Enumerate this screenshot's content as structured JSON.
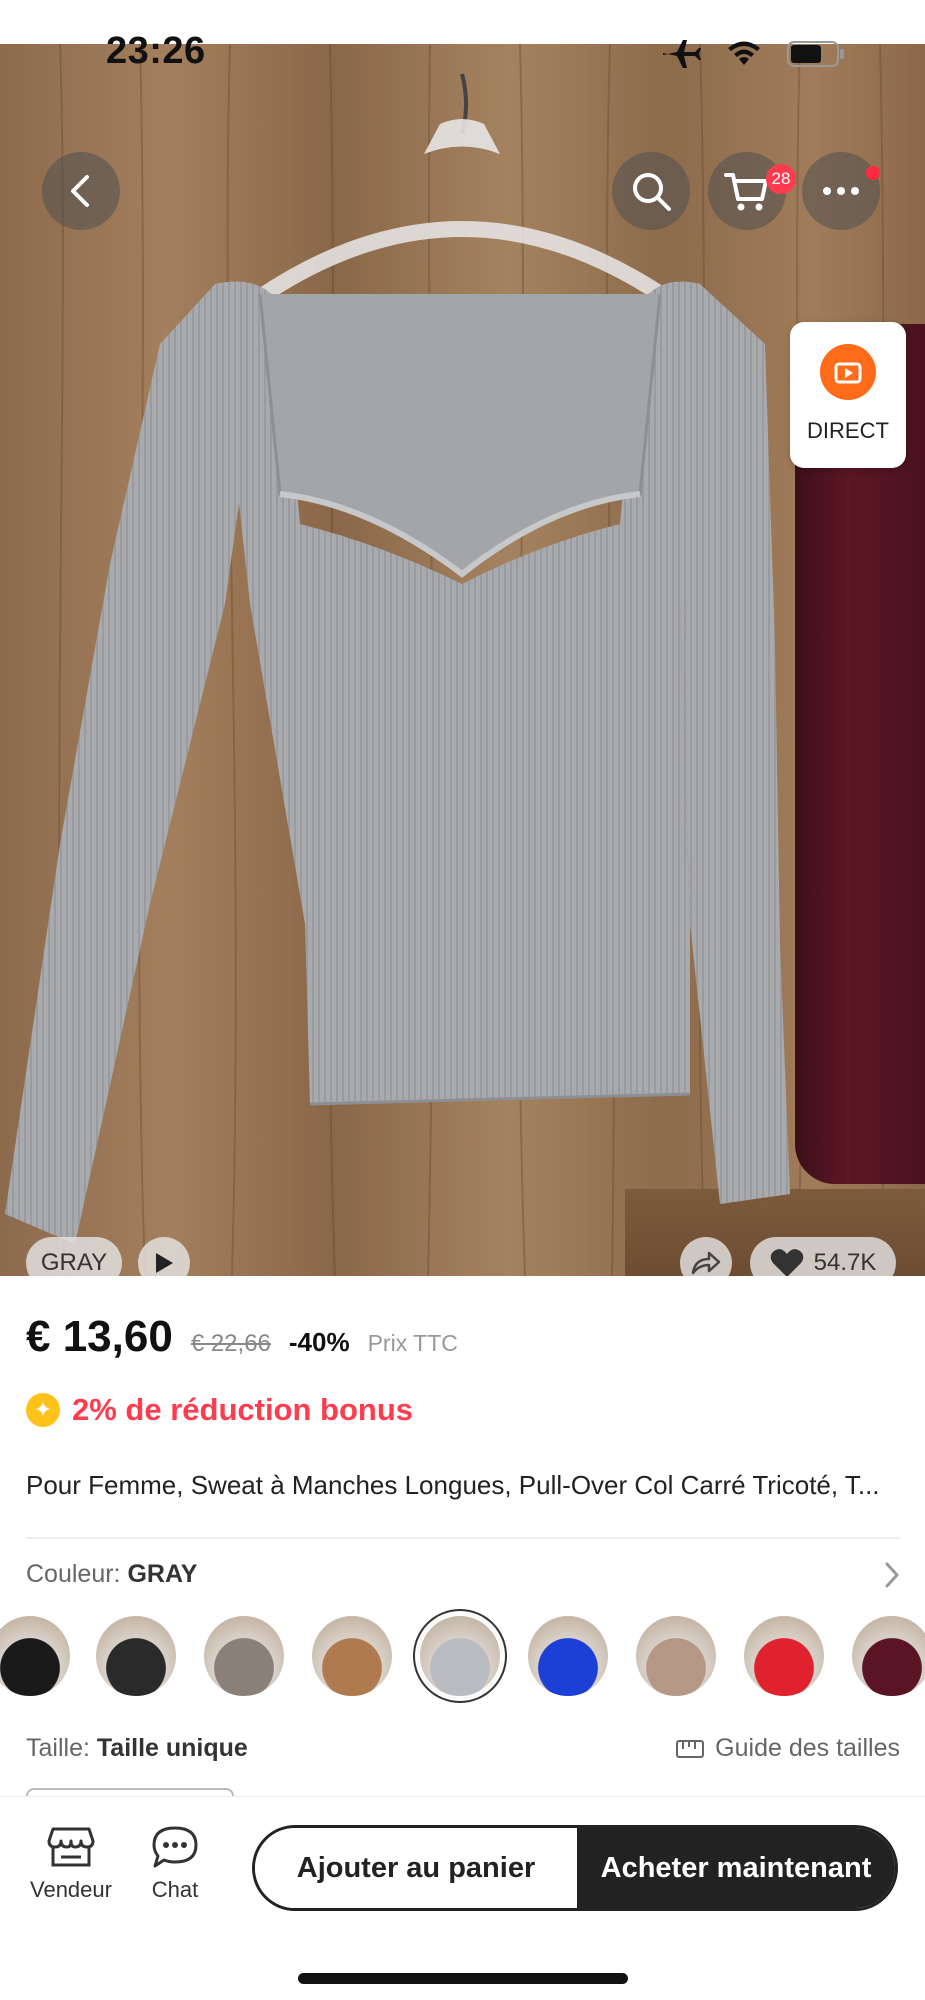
{
  "status_bar": {
    "time": "23:26",
    "icons": [
      "airplane-icon",
      "wifi-icon",
      "battery-icon"
    ]
  },
  "hero": {
    "cart_count": "28",
    "live_label": "DIRECT",
    "selected_color_tag": "GRAY",
    "likes": "54.7K"
  },
  "product": {
    "price": "€ 13,60",
    "old_price": "€ 22,66",
    "discount": "-40%",
    "tax_note": "Prix TTC",
    "bonus": "2% de réduction bonus",
    "title": "Pour Femme, Sweat à Manches Longues, Pull-Over Col Carré Tricoté, T..."
  },
  "color": {
    "label": "Couleur: ",
    "value": "GRAY",
    "swatches": [
      {
        "name": "white-black",
        "color": "#1a1a1a",
        "selected": false
      },
      {
        "name": "black",
        "color": "#2a2a2a",
        "selected": false
      },
      {
        "name": "taupe",
        "color": "#8a7f79",
        "selected": false
      },
      {
        "name": "camel",
        "color": "#b07a4f",
        "selected": false
      },
      {
        "name": "gray",
        "color": "#b9bcc0",
        "selected": true
      },
      {
        "name": "blue",
        "color": "#1c3fd6",
        "selected": false
      },
      {
        "name": "beige",
        "color": "#b69886",
        "selected": false
      },
      {
        "name": "red",
        "color": "#e0222f",
        "selected": false
      },
      {
        "name": "burgundy",
        "color": "#5a1424",
        "selected": false
      }
    ]
  },
  "size": {
    "label": "Taille: ",
    "value": "Taille unique",
    "guide": "Guide des tailles"
  },
  "bottom_bar": {
    "seller": "Vendeur",
    "chat": "Chat",
    "add_to_cart": "Ajouter au panier",
    "buy_now": "Acheter maintenant"
  },
  "colors": {
    "accent": "#ff3b4e",
    "dark": "#222222",
    "bonus_coin": "#ffc21a",
    "live": "#ff6b18"
  }
}
